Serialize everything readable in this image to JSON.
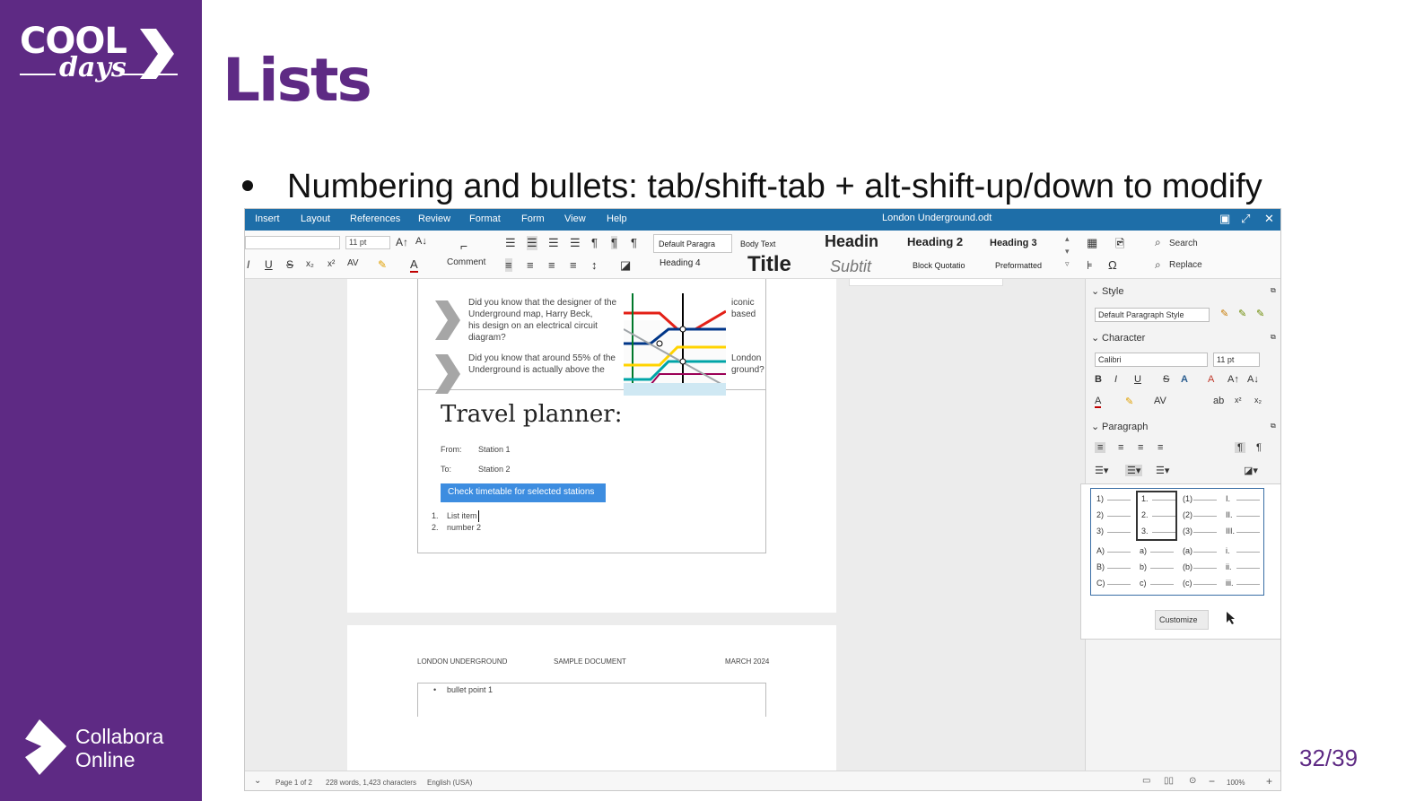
{
  "branding": {
    "cool_word": "COOL",
    "days_word": "days",
    "collabora_line1": "Collabora",
    "collabora_line2": "Online",
    "purple": "#5e2a84"
  },
  "slide": {
    "title": "Lists",
    "bullet": "Numbering and bullets: tab/shift-tab + alt-shift-up/down to modify",
    "page_number": "32/39"
  },
  "app": {
    "menu": [
      "Insert",
      "Layout",
      "References",
      "Review",
      "Format",
      "Form",
      "View",
      "Help"
    ],
    "doc_title": "London Underground.odt",
    "accent": "#1e6ea8",
    "toolbar": {
      "font_size": "11 pt",
      "comment_label": "Comment",
      "search_label": "Search",
      "replace_label": "Replace",
      "styles": [
        "Default Paragra",
        "Body Text",
        "Headin",
        "Heading 2",
        "Heading 3",
        "Heading 4",
        "Title",
        "Subtit",
        "Block Quotatio",
        "Preformatted"
      ]
    },
    "document": {
      "fact1": [
        "Did you know that the designer of the",
        "Underground map, Harry Beck,",
        "his design on an electrical circuit",
        "diagram?"
      ],
      "fact1_right": [
        "iconic",
        "based"
      ],
      "fact2": [
        "Did you know that around 55% of the",
        "Underground is actually above the"
      ],
      "fact2_right": [
        "London",
        "ground?"
      ],
      "planner_title": "Travel planner:",
      "from_label": "From:",
      "from_value": "Station 1",
      "to_label": "To:",
      "to_value": "Station 2",
      "check_button": "Check timetable for selected stations",
      "list_item_1_num": "1.",
      "list_item_1": "List item",
      "list_item_2_num": "2.",
      "list_item_2": "number 2",
      "header_left": "LONDON UNDERGROUND",
      "header_mid": "SAMPLE DOCUMENT",
      "header_right": "MARCH 2024",
      "bullet_point": "bullet point 1"
    },
    "sidebar": {
      "style_heading": "Style",
      "style_value": "Default Paragraph Style",
      "character_heading": "Character",
      "font_value": "Calibri",
      "size_value": "11 pt",
      "paragraph_heading": "Paragraph"
    },
    "numbering_popup": {
      "columns": [
        [
          "1)",
          "2)",
          "3)"
        ],
        [
          "1.",
          "2.",
          "3."
        ],
        [
          "(1)",
          "(2)",
          "(3)"
        ],
        [
          "I.",
          "II.",
          "III."
        ]
      ],
      "columns_b": [
        [
          "A)",
          "B)",
          "C)"
        ],
        [
          "a)",
          "b)",
          "c)"
        ],
        [
          "(a)",
          "(b)",
          "(c)"
        ],
        [
          "i.",
          "ii.",
          "iii."
        ]
      ],
      "customize_label": "Customize"
    },
    "status": {
      "page": "Page 1 of 2",
      "words": "228 words, 1,423 characters",
      "language": "English (USA)",
      "zoom": "100%"
    }
  }
}
